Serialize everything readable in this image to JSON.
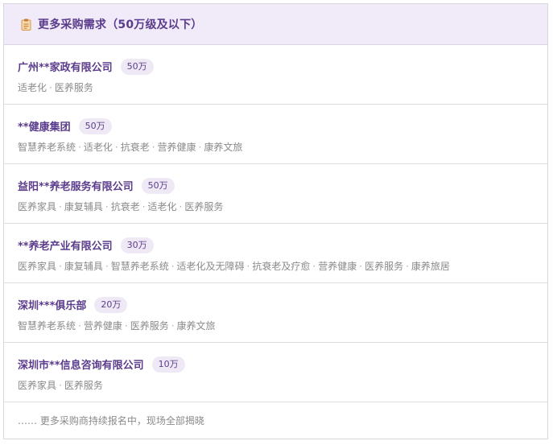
{
  "header": {
    "icon": "clipboard-icon",
    "title": "更多采购需求（50万级及以下）"
  },
  "items": [
    {
      "company": "广州**家政有限公司",
      "budget": "50万",
      "tags": [
        "适老化",
        "医养服务"
      ]
    },
    {
      "company": "**健康集团",
      "budget": "50万",
      "tags": [
        "智慧养老系统",
        "适老化",
        "抗衰老",
        "营养健康",
        "康养文旅"
      ]
    },
    {
      "company": "益阳**养老服务有限公司",
      "budget": "50万",
      "tags": [
        "医养家具",
        "康复辅具",
        "抗衰老",
        "适老化",
        "医养服务"
      ]
    },
    {
      "company": "**养老产业有限公司",
      "budget": "30万",
      "tags": [
        "医养家具",
        "康复辅具",
        "智慧养老系统",
        "适老化及无障碍",
        "抗衰老及疗愈",
        "营养健康",
        "医养服务",
        "康养旅居"
      ]
    },
    {
      "company": "深圳***俱乐部",
      "budget": "20万",
      "tags": [
        "智慧养老系统",
        "营养健康",
        "医养服务",
        "康养文旅"
      ]
    },
    {
      "company": "深圳市**信息咨询有限公司",
      "budget": "10万",
      "tags": [
        "医养家具",
        "医养服务"
      ]
    }
  ],
  "footer": {
    "text": "…… 更多采购商持续报名中，现场全部揭晓"
  },
  "colors": {
    "accent": "#5b3c8c",
    "header_bg": "#f1ebf9",
    "badge_bg": "#efe9f6"
  }
}
